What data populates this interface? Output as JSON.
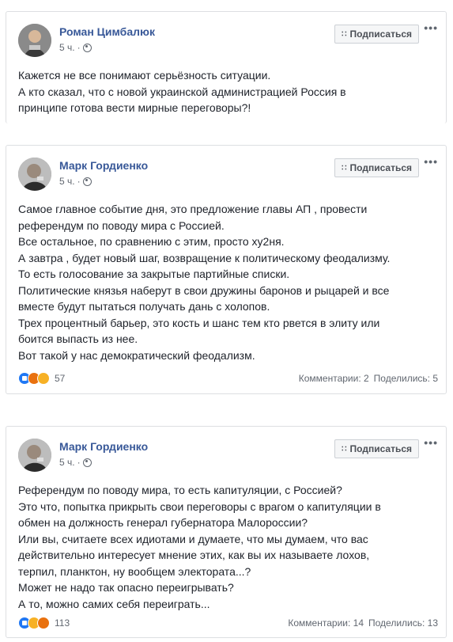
{
  "posts": [
    {
      "author": "Роман Цимбалюк",
      "time": "5 ч.",
      "subscribe_label": "Подписаться",
      "menu": "•••",
      "lines": [
        "Кажется не все понимают серьёзность ситуации.",
        "А кто сказал, что с новой украинской администрацией Россия в",
        "принципе готова вести мирные переговоры?!"
      ]
    },
    {
      "author": "Марк Гордиенко",
      "time": "5 ч.",
      "subscribe_label": "Подписаться",
      "menu": "•••",
      "lines": [
        "Самое главное событие дня, это предложение главы АП , провести",
        "референдум по поводу мира с Россией.",
        "Все остальное, по сравнению с этим, просто ху2ня.",
        "А завтра , будет новый шаг, возвращение к политическому феодализму.",
        "То есть голосование за закрытые партийные списки.",
        "Политические князья наберут в свои дружины баронов и рыцарей и все",
        "вместе будут пытаться получать дань с холопов.",
        "Трех процентный барьер, это кость и шанс тем кто рвется в элиту или",
        "боится выпасть из нее.",
        "Вот такой у нас демократический феодализм."
      ],
      "reactions_count": "57",
      "reactions": [
        "like",
        "angry",
        "sad"
      ],
      "comments": "Комментарии: 2",
      "shares": "Поделились: 5"
    },
    {
      "author": "Марк Гордиенко",
      "time": "5 ч.",
      "subscribe_label": "Подписаться",
      "menu": "•••",
      "lines": [
        "Референдум по поводу мира, то есть капитуляции, с Россией?",
        "Это что, попытка прикрыть свои переговоры с врагом о капитуляции в",
        "обмен на должность генерал губернатора Малороссии?",
        "Или вы, считаете всех идиотами и думаете, что мы думаем, что вас",
        "действительно интересует мнение этих, как вы их называете лохов,",
        "терпил, планктон, ну вообщем электората...?",
        "Может не надо так опасно переигрывать?",
        "А то, можно самих себя переиграть..."
      ],
      "reactions_count": "113",
      "reactions": [
        "like",
        "sad",
        "angry"
      ],
      "comments": "Комментарии: 14",
      "shares": "Поделились: 13"
    }
  ],
  "colors": {
    "author": "#385898",
    "text": "#1d2129",
    "meta": "#616770",
    "like": "#2078f4",
    "sad": "#f7b125",
    "angry": "#e9710f"
  },
  "icons": {
    "globe": "globe-icon",
    "rss": "rss-icon",
    "more": "more-icon"
  }
}
